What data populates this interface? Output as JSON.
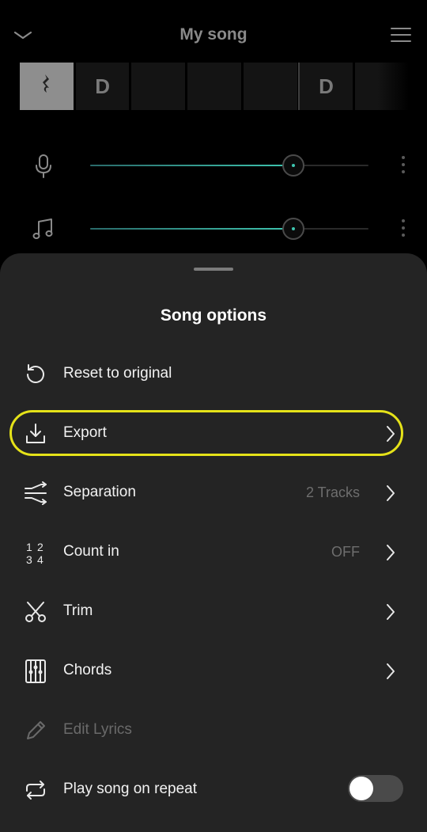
{
  "header": {
    "title": "My song",
    "back_icon": "chevron-down-icon",
    "menu_icon": "hamburger-menu-icon"
  },
  "chord_strip": {
    "cells": [
      "",
      "D",
      "",
      "",
      "",
      "D",
      ""
    ],
    "first_cell_icon": "quarter-rest-icon"
  },
  "tracks": [
    {
      "icon": "microphone-icon",
      "level": 0.73
    },
    {
      "icon": "music-note-icon",
      "level": 0.73
    }
  ],
  "sheet": {
    "title": "Song options",
    "options": [
      {
        "label": "Reset to original",
        "icon": "reset-icon"
      },
      {
        "label": "Export",
        "icon": "download-icon"
      },
      {
        "label": "Separation",
        "icon": "split-icon",
        "value": "2 Tracks"
      },
      {
        "label": "Count in",
        "icon": "count-in-icon",
        "value": "OFF"
      },
      {
        "label": "Trim",
        "icon": "scissors-icon"
      },
      {
        "label": "Chords",
        "icon": "chord-grid-icon"
      },
      {
        "label": "Edit Lyrics",
        "icon": "pencil-icon",
        "disabled": true
      },
      {
        "label": "Play song on repeat",
        "icon": "repeat-icon",
        "toggle_on": false
      }
    ],
    "count_in_digits": [
      "1",
      "2",
      "3",
      "4"
    ]
  },
  "colors": {
    "highlight": "#e5e219",
    "accent": "#3ec6b0",
    "sheet_bg": "#242424"
  }
}
